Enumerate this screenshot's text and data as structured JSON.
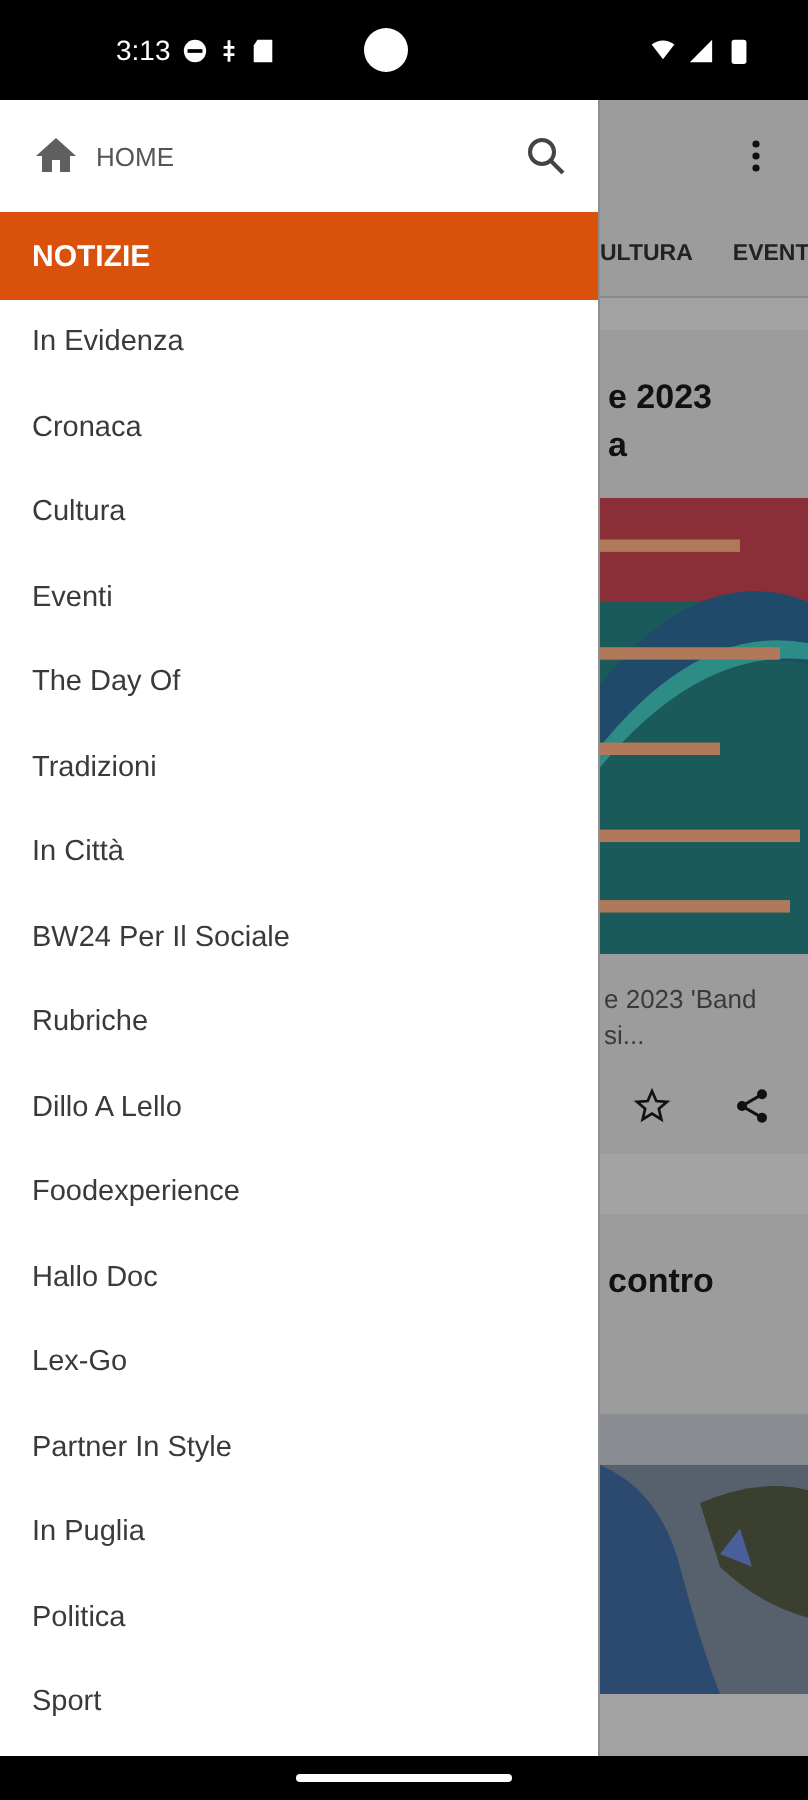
{
  "status_bar": {
    "time": "3:13"
  },
  "drawer": {
    "home_label": "HOME",
    "section": "NOTIZIE",
    "items": [
      {
        "label": "In Evidenza"
      },
      {
        "label": "Cronaca"
      },
      {
        "label": "Cultura"
      },
      {
        "label": "Eventi"
      },
      {
        "label": "The Day Of"
      },
      {
        "label": "Tradizioni"
      },
      {
        "label": "In Città"
      },
      {
        "label": "BW24 Per Il Sociale"
      },
      {
        "label": "Rubriche"
      },
      {
        "label": "Dillo A Lello"
      },
      {
        "label": "Foodexperience"
      },
      {
        "label": "Hallo Doc"
      },
      {
        "label": "Lex-Go"
      },
      {
        "label": "Partner In Style"
      },
      {
        "label": "In Puglia"
      },
      {
        "label": "Politica"
      },
      {
        "label": "Sport"
      }
    ]
  },
  "background": {
    "tabs": [
      "ULTURA",
      "EVENT"
    ],
    "cards": [
      {
        "title_lines": [
          "e 2023",
          "a"
        ],
        "excerpt_lines": [
          "e 2023 'Band",
          "si..."
        ],
        "actions": true
      },
      {
        "title_lines": [
          "contro"
        ],
        "actions": false
      }
    ]
  }
}
